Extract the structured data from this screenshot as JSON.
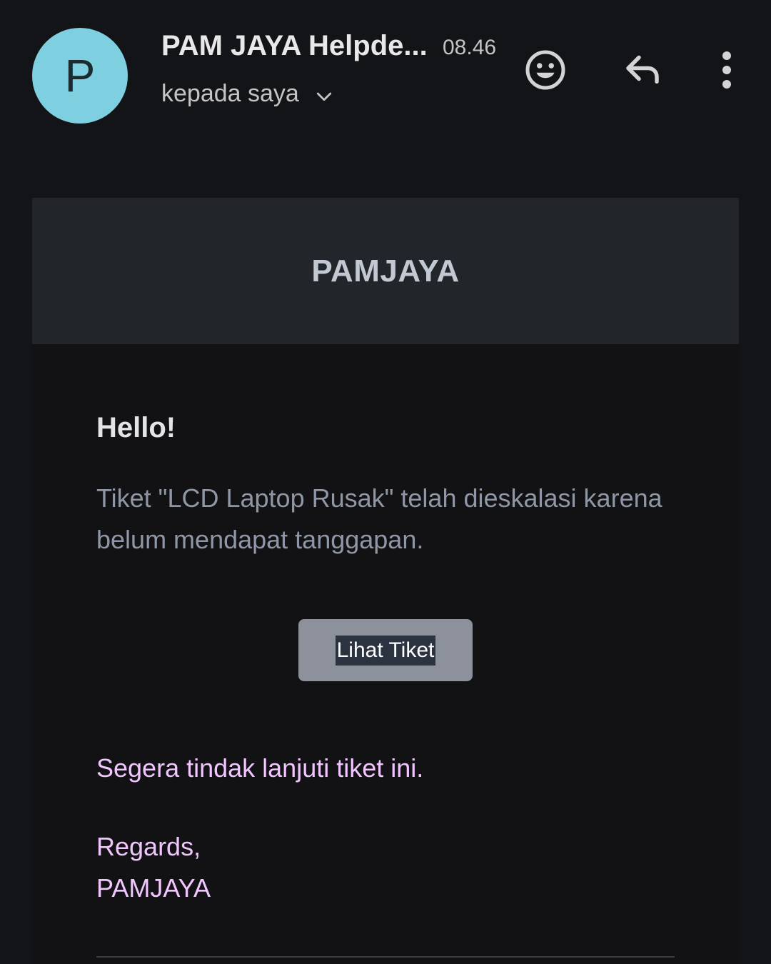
{
  "header": {
    "avatar_letter": "P",
    "sender": "PAM JAYA Helpde...",
    "time": "08.46",
    "recipient": "kepada saya",
    "icons": {
      "expand": "chevron-down-icon",
      "emoji": "emoji-reaction-icon",
      "reply": "reply-icon",
      "more": "more-vert-icon"
    }
  },
  "email": {
    "brand": "PAMJAYA",
    "greeting": "Hello!",
    "message": "Tiket \"LCD Laptop Rusak\" telah dieskalasi karena belum mendapat tanggapan.",
    "button_label": "Lihat Tiket",
    "action_text": "Segera tindak lanjuti tiket ini.",
    "regards_line": "Regards,",
    "signature": "PAMJAYA"
  },
  "colors": {
    "background": "#131418",
    "avatar": "#7ecfe0",
    "banner": "#222529",
    "button": "#8c919c",
    "highlight_text": "#f1c6ff",
    "muted_text": "#8f97a6"
  }
}
